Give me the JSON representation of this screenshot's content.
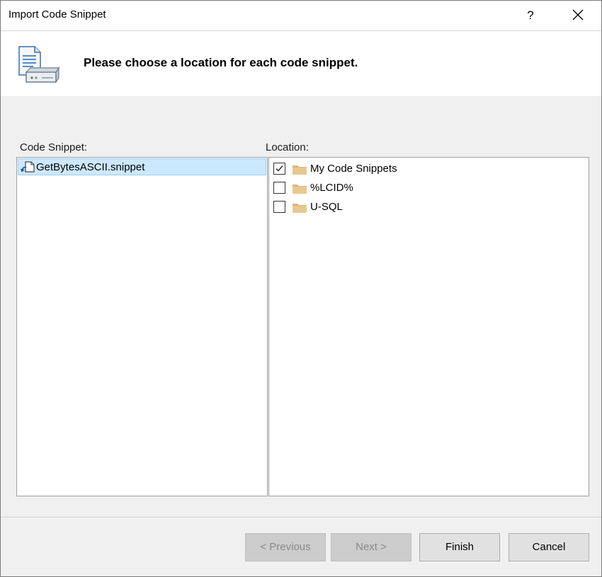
{
  "window": {
    "title": "Import Code Snippet",
    "help_label": "?"
  },
  "banner": {
    "icon": "snippet-import-icon",
    "text": "Please choose a location for each code snippet."
  },
  "snippets": {
    "label": "Code Snippet:",
    "items": [
      {
        "name": "GetBytesASCII.snippet",
        "icon": "snippet-file-icon",
        "selected": true
      }
    ]
  },
  "locations": {
    "label": "Location:",
    "items": [
      {
        "name": "My Code Snippets",
        "checked": true,
        "icon": "folder-icon"
      },
      {
        "name": "%LCID%",
        "checked": false,
        "icon": "folder-icon"
      },
      {
        "name": "U-SQL",
        "checked": false,
        "icon": "folder-icon"
      }
    ]
  },
  "buttons": {
    "previous": "< Previous",
    "next": "Next >",
    "finish": "Finish",
    "cancel": "Cancel"
  },
  "colors": {
    "selection": "#cce8ff",
    "folder": "#dcb67a",
    "disabled_button": "#cccccc"
  }
}
